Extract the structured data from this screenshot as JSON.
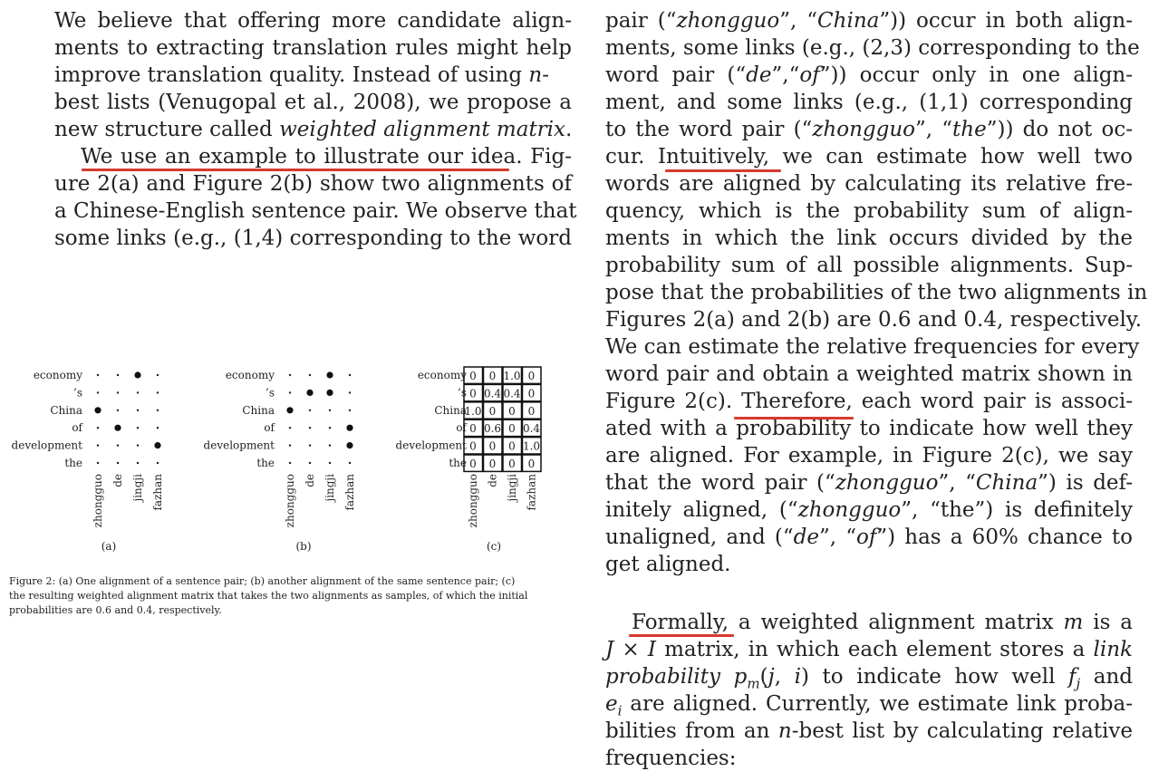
{
  "left_paragraph_1": {
    "lines": [
      "We believe that offering more candidate align-",
      "ments to extracting translation rules might help",
      "improve translation quality.  Instead of using ",
      "best lists (Venugopal et al., 2008), we propose a",
      "new structure called "
    ],
    "n_symbol": "n",
    "n_suffix": "-",
    "term": "weighted alignment matrix",
    "term_end": "."
  },
  "left_paragraph_2": {
    "lines": [
      "We use an example to illustrate our idea.  Fig-",
      "ure 2(a) and Figure 2(b) show two alignments of",
      "a Chinese-English sentence pair. We observe that",
      "some links (e.g., (1,4) corresponding to the word"
    ]
  },
  "right_paragraph_1": {
    "l1": [
      "pair (“",
      "zhongguo",
      "”, “",
      "China",
      "”)) occur in both align-"
    ],
    "l2": "ments, some links (e.g., (2,3) corresponding to the",
    "l3": [
      "word pair (“",
      "de",
      "”,“",
      "of",
      "”)) occur only in one align-"
    ],
    "l4": "ment, and some links (e.g., (1,1) corresponding",
    "l5": [
      "to the word pair (“",
      "zhongguo",
      "”, “",
      "the",
      "”)) do not oc-"
    ],
    "l6": "cur.  Intuitively, we can estimate how well two",
    "l7": "words are aligned by calculating its relative fre-",
    "l8": "quency, which is the probability sum of align-",
    "l9": "ments in which the link occurs divided by the",
    "l10": "probability sum of all possible alignments.  Sup-",
    "l11": "pose that the probabilities of the two alignments in",
    "l12": "Figures 2(a) and 2(b) are 0.6 and 0.4, respectively.",
    "l13": "We can estimate the relative frequencies for every",
    "l14": "word pair and obtain a weighted matrix shown in",
    "l15": "Figure 2(c).  Therefore, each word pair is associ-",
    "l16": "ated with a probability to indicate how well they",
    "l17": "are aligned.  For example, in Figure 2(c), we say",
    "l18": [
      "that the word pair (“",
      "zhongguo",
      "”, “",
      "China",
      "”) is def-"
    ],
    "l19": [
      "initely aligned, (“",
      "zhongguo",
      "”, “the”) is definitely"
    ],
    "l20": [
      "unaligned, and (“",
      "de",
      "”, “",
      "of",
      "”) has a 60% chance to"
    ],
    "l21": "get aligned."
  },
  "right_paragraph_2": {
    "l1": [
      "Formally, a weighted alignment matrix ",
      "m",
      " is a"
    ],
    "l2": [
      "J",
      " × ",
      "I",
      " matrix, in which each element stores a ",
      "link"
    ],
    "l3": [
      "probability",
      " ",
      "p",
      "m",
      "(",
      "j",
      ", ",
      "i",
      ") to indicate how well ",
      "f",
      "j",
      " and"
    ],
    "l4": [
      "e",
      "i",
      " are aligned. Currently, we estimate link proba-"
    ],
    "l5": [
      "bilities from an ",
      "n",
      "-best list by calculating relative"
    ],
    "l6": "frequencies:"
  },
  "figure": {
    "source_words": [
      "zhongguo",
      "de",
      "jingji",
      "fazhan"
    ],
    "target_words": [
      "economy",
      "’s",
      "China",
      "of",
      "development",
      "the"
    ],
    "alignment_a": [
      [
        0,
        0,
        1,
        0
      ],
      [
        0,
        0,
        0,
        0
      ],
      [
        1,
        0,
        0,
        0
      ],
      [
        0,
        1,
        0,
        0
      ],
      [
        0,
        0,
        0,
        1
      ],
      [
        0,
        0,
        0,
        0
      ]
    ],
    "alignment_b": [
      [
        0,
        0,
        1,
        0
      ],
      [
        0,
        1,
        1,
        0
      ],
      [
        1,
        0,
        0,
        0
      ],
      [
        0,
        0,
        0,
        1
      ],
      [
        0,
        0,
        0,
        1
      ],
      [
        0,
        0,
        0,
        0
      ]
    ],
    "matrix_c": [
      [
        "0",
        "0",
        "1.0",
        "0"
      ],
      [
        "0",
        "0.4",
        "0.4",
        "0"
      ],
      [
        "1.0",
        "0",
        "0",
        "0"
      ],
      [
        "0",
        "0.6",
        "0",
        "0.4"
      ],
      [
        "0",
        "0",
        "0",
        "1.0"
      ],
      [
        "0",
        "0",
        "0",
        "0"
      ]
    ],
    "subcaptions": [
      "(a)",
      "(b)",
      "(c)"
    ],
    "caption_lines": [
      "Figure 2:  (a) One alignment of a sentence pair; (b) another alignment of the same sentence pair; (c)",
      "the resulting weighted alignment matrix that takes the two alignments as samples, of which the initial",
      "probabilities are 0.6 and 0.4, respectively."
    ]
  },
  "highlight_color": "#d63a2f"
}
